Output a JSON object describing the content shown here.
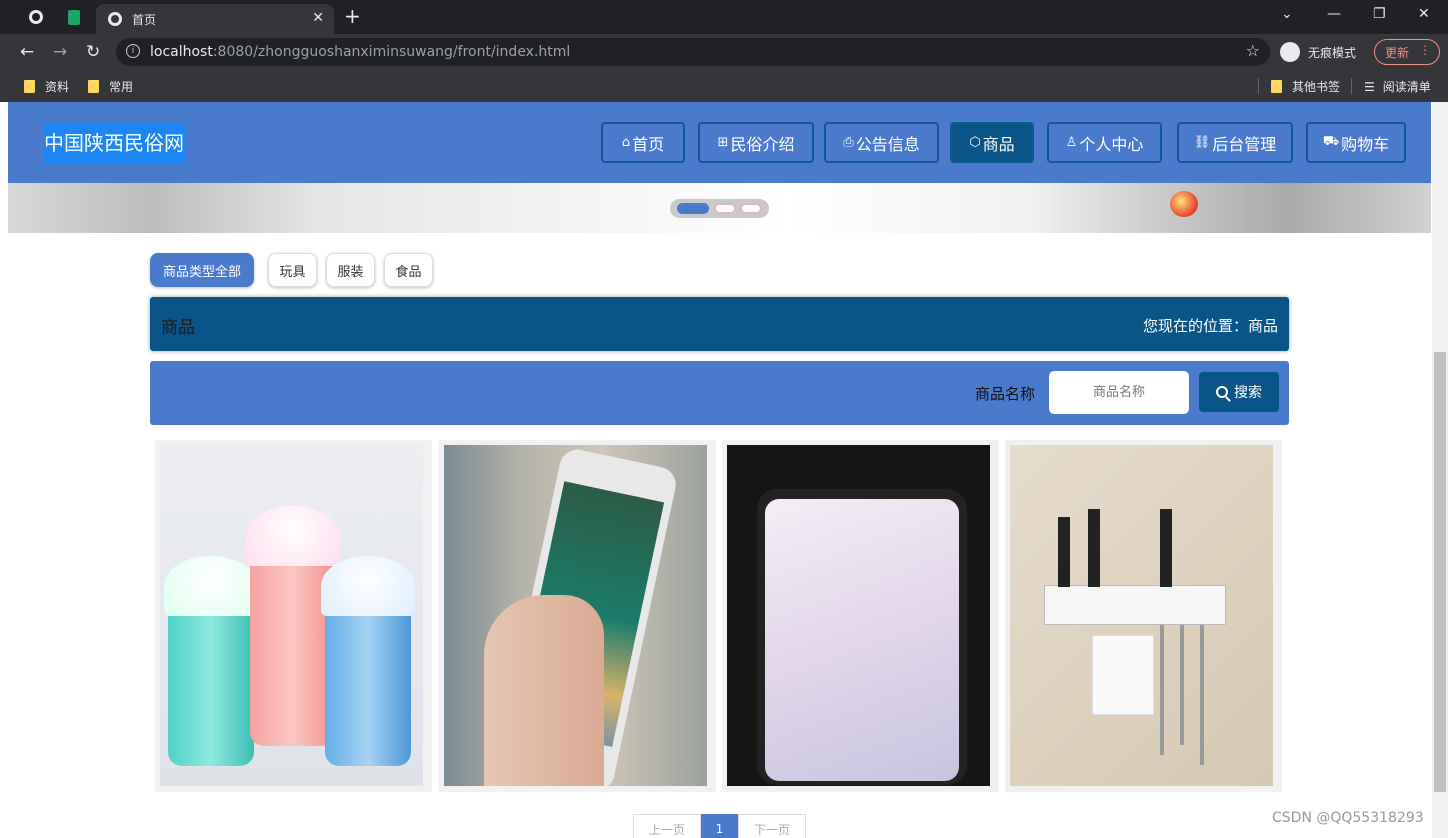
{
  "browser": {
    "tab_title": "首页",
    "url_host": "localhost",
    "url_rest": ":8080/zhongguoshanximinsuwang/front/index.html",
    "incognito_label": "无痕模式",
    "update_label": "更新",
    "bookmarks": [
      "资料",
      "常用"
    ],
    "other_bookmarks": "其他书签",
    "reading_list": "阅读清单"
  },
  "site": {
    "logo": "中国陕西民俗网",
    "nav": [
      {
        "label": "首页",
        "icon": "home-icon"
      },
      {
        "label": "民俗介绍",
        "icon": "gift-icon"
      },
      {
        "label": "公告信息",
        "icon": "printer-icon"
      },
      {
        "label": "商品",
        "icon": "box-icon"
      },
      {
        "label": "个人中心",
        "icon": "user-icon"
      },
      {
        "label": "后台管理",
        "icon": "link-icon"
      },
      {
        "label": "购物车",
        "icon": "cart-icon"
      }
    ],
    "active_nav": "商品"
  },
  "filters": [
    "商品类型全部",
    "玩具",
    "服装",
    "食品"
  ],
  "section": {
    "title": "商品",
    "location": "您现在的位置：商品"
  },
  "search": {
    "label": "商品名称",
    "placeholder": "商品名称",
    "button": "搜索"
  },
  "products": [
    {
      "image": "toy-cups"
    },
    {
      "image": "iphone-hand"
    },
    {
      "image": "android-phone"
    },
    {
      "image": "kitchen-rack"
    }
  ],
  "pagination": {
    "prev": "上一页",
    "current": "1",
    "next": "下一页"
  },
  "watermark": "CSDN @QQ55318293",
  "colors": {
    "primary": "#4a7acb",
    "dark": "#0a5587",
    "logo_bg": "#1b86f4"
  }
}
